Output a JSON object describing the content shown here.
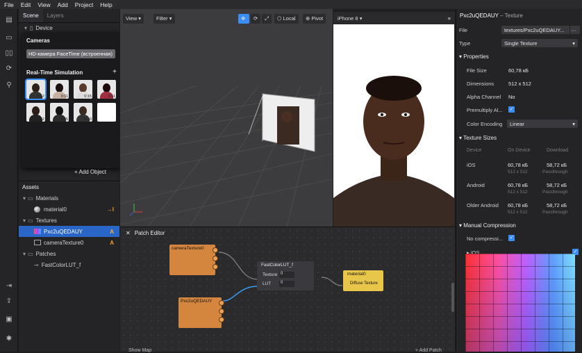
{
  "menu": [
    "File",
    "Edit",
    "View",
    "Add",
    "Project",
    "Help"
  ],
  "scene_panel": {
    "tabs": [
      "Scene",
      "Layers"
    ],
    "device_label": "Device",
    "cameras_title": "Cameras",
    "camera_selected": "HD-камера FaceTime (встроенная)",
    "simulation_title": "Real-Time Simulation",
    "add_symbol": "+",
    "thumb_times": [
      "0:12",
      "0:11",
      "0:15",
      "0:11",
      "0:12",
      "0:15",
      "0:10",
      ""
    ],
    "add_object": "+ Add Object"
  },
  "assets": {
    "title": "Assets",
    "items": [
      {
        "label": "Materials",
        "badge": ""
      },
      {
        "label": "material0",
        "badge": "→I"
      },
      {
        "label": "Textures",
        "badge": ""
      },
      {
        "label": "Pxc2uQEDAUY",
        "badge": "A"
      },
      {
        "label": "cameraTexture0",
        "badge": "A"
      },
      {
        "label": "Patches",
        "badge": ""
      },
      {
        "label": "FastColorLUT_f",
        "badge": ""
      }
    ]
  },
  "viewport_toolbar": {
    "view": "View",
    "filter": "Filter",
    "local": "Local",
    "pivot": "Pivot"
  },
  "preview": {
    "device": "iPhone 8"
  },
  "patch_editor": {
    "title": "Patch Editor",
    "node_camera": "cameraTexture0",
    "node_texture": "Pxc2uQEDAUY",
    "node_lut": "FastColorLUT_f",
    "lut_in_texture": "Texture",
    "lut_in_lut": "LUT",
    "lut_val1": "0",
    "lut_val2": "0",
    "node_material": "material0",
    "material_in": "Diffuse Texture",
    "show_map": "Show Map",
    "add_patch": "+ Add Patch"
  },
  "inspector": {
    "title": "Pxc2uQEDAUY",
    "subtitle": "– Texture",
    "file_label": "File",
    "file_value": "textures/Pxc2uQEDAUY...",
    "file_more": "···",
    "type_label": "Type",
    "type_value": "Single Texture",
    "properties_header": "Properties",
    "file_size_label": "File Size",
    "file_size_value": "60,78 кБ",
    "dimensions_label": "Dimensions",
    "dimensions_value": "512 x 512",
    "alpha_label": "Alpha Channel",
    "alpha_value": "No",
    "premult_label": "Premultiply Al...",
    "encoding_label": "Color Encoding",
    "encoding_value": "Linear",
    "sizes_header": "Texture Sizes",
    "col_device": "Device",
    "col_ondevice": "On Device",
    "col_download": "Download",
    "sizes": [
      {
        "device": "iOS",
        "on": "60,78 кБ",
        "dl": "58,72 кБ",
        "on_sub": "512 x 512",
        "dl_sub": "Passthrough"
      },
      {
        "device": "Android",
        "on": "60,78 кБ",
        "dl": "58,72 кБ",
        "on_sub": "512 x 512",
        "dl_sub": "Passthrough"
      },
      {
        "device": "Older Android",
        "on": "60,78 кБ",
        "dl": "58,72 кБ",
        "on_sub": "512 x 512",
        "dl_sub": "Passthrough"
      }
    ],
    "manual_header": "Manual Compression",
    "no_compress_label": "No compressi...",
    "ios_label": "iOS"
  },
  "colors": {
    "accent": "#3a8ef6",
    "patch_orange": "#d4863e",
    "patch_yellow": "#e8c64a",
    "selection": "#2a65c8"
  }
}
